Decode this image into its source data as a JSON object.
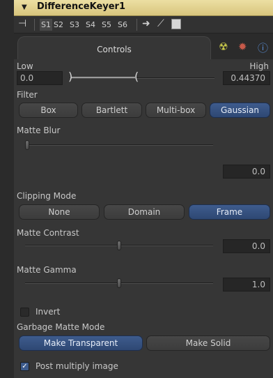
{
  "tool": {
    "title": "DifferenceKeyer1",
    "collapse_icon": "triangle-down-icon"
  },
  "toolbar": {
    "slots": [
      "S1",
      "S2",
      "S3",
      "S4",
      "S5",
      "S6"
    ],
    "active_slot": "S1"
  },
  "tabs": {
    "controls_label": "Controls",
    "extra_icons": [
      "radiation-icon",
      "gear-icon",
      "info-icon"
    ]
  },
  "range": {
    "low_label": "Low",
    "high_label": "High",
    "low_value": "0.0",
    "high_value": "0.44370",
    "low_fraction": 0.0,
    "high_fraction": 0.4437
  },
  "filter": {
    "label": "Filter",
    "options": [
      "Box",
      "Bartlett",
      "Multi-box",
      "Gaussian"
    ],
    "selected": "Gaussian"
  },
  "matte_blur": {
    "label": "Matte Blur",
    "value": "0.0"
  },
  "clipping": {
    "label": "Clipping Mode",
    "options": [
      "None",
      "Domain",
      "Frame"
    ],
    "selected": "Frame"
  },
  "matte_contrast": {
    "label": "Matte Contrast",
    "value": "0.0"
  },
  "matte_gamma": {
    "label": "Matte Gamma",
    "value": "1.0"
  },
  "invert": {
    "label": "Invert",
    "checked": false
  },
  "garbage": {
    "label": "Garbage Matte Mode",
    "options": [
      "Make Transparent",
      "Make Solid"
    ],
    "selected": "Make Transparent"
  },
  "post_multiply": {
    "label": "Post multiply image",
    "checked": true
  },
  "colors": {
    "title_bar": "#e3d391",
    "selected_button": "#3a5686",
    "panel_bg": "#363636"
  }
}
